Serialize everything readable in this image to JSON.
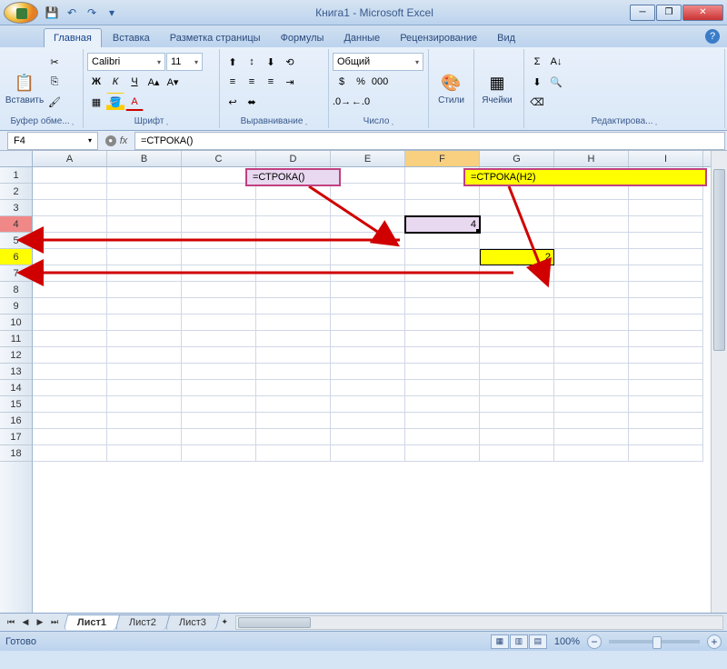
{
  "title": "Книга1 - Microsoft Excel",
  "tabs": {
    "home": "Главная",
    "insert": "Вставка",
    "layout": "Разметка страницы",
    "formulas": "Формулы",
    "data": "Данные",
    "review": "Рецензирование",
    "view": "Вид"
  },
  "ribbon": {
    "clipboard": {
      "label": "Буфер обме...",
      "paste": "Вставить"
    },
    "font": {
      "label": "Шрифт",
      "name": "Calibri",
      "size": "11",
      "bold": "Ж",
      "italic": "К",
      "underline": "Ч"
    },
    "alignment": {
      "label": "Выравнивание"
    },
    "number": {
      "label": "Число",
      "format": "Общий"
    },
    "styles": {
      "label": "Стили"
    },
    "cells": {
      "label": "Ячейки"
    },
    "editing": {
      "label": "Редактирова..."
    }
  },
  "formula_bar": {
    "name_box": "F4",
    "fx": "fx",
    "formula": "=СТРОКА()"
  },
  "annotations": {
    "formula1": "=СТРОКА()",
    "formula2": "=СТРОКА(H2)"
  },
  "columns": [
    "A",
    "B",
    "C",
    "D",
    "E",
    "F",
    "G",
    "H",
    "I"
  ],
  "rows": [
    "1",
    "2",
    "3",
    "4",
    "5",
    "6",
    "7",
    "8",
    "9",
    "10",
    "11",
    "12",
    "13",
    "14",
    "15",
    "16",
    "17",
    "18"
  ],
  "cell_F4": "4",
  "cell_G6": "2",
  "sheets": {
    "s1": "Лист1",
    "s2": "Лист2",
    "s3": "Лист3"
  },
  "status": {
    "ready": "Готово",
    "zoom": "100%"
  }
}
